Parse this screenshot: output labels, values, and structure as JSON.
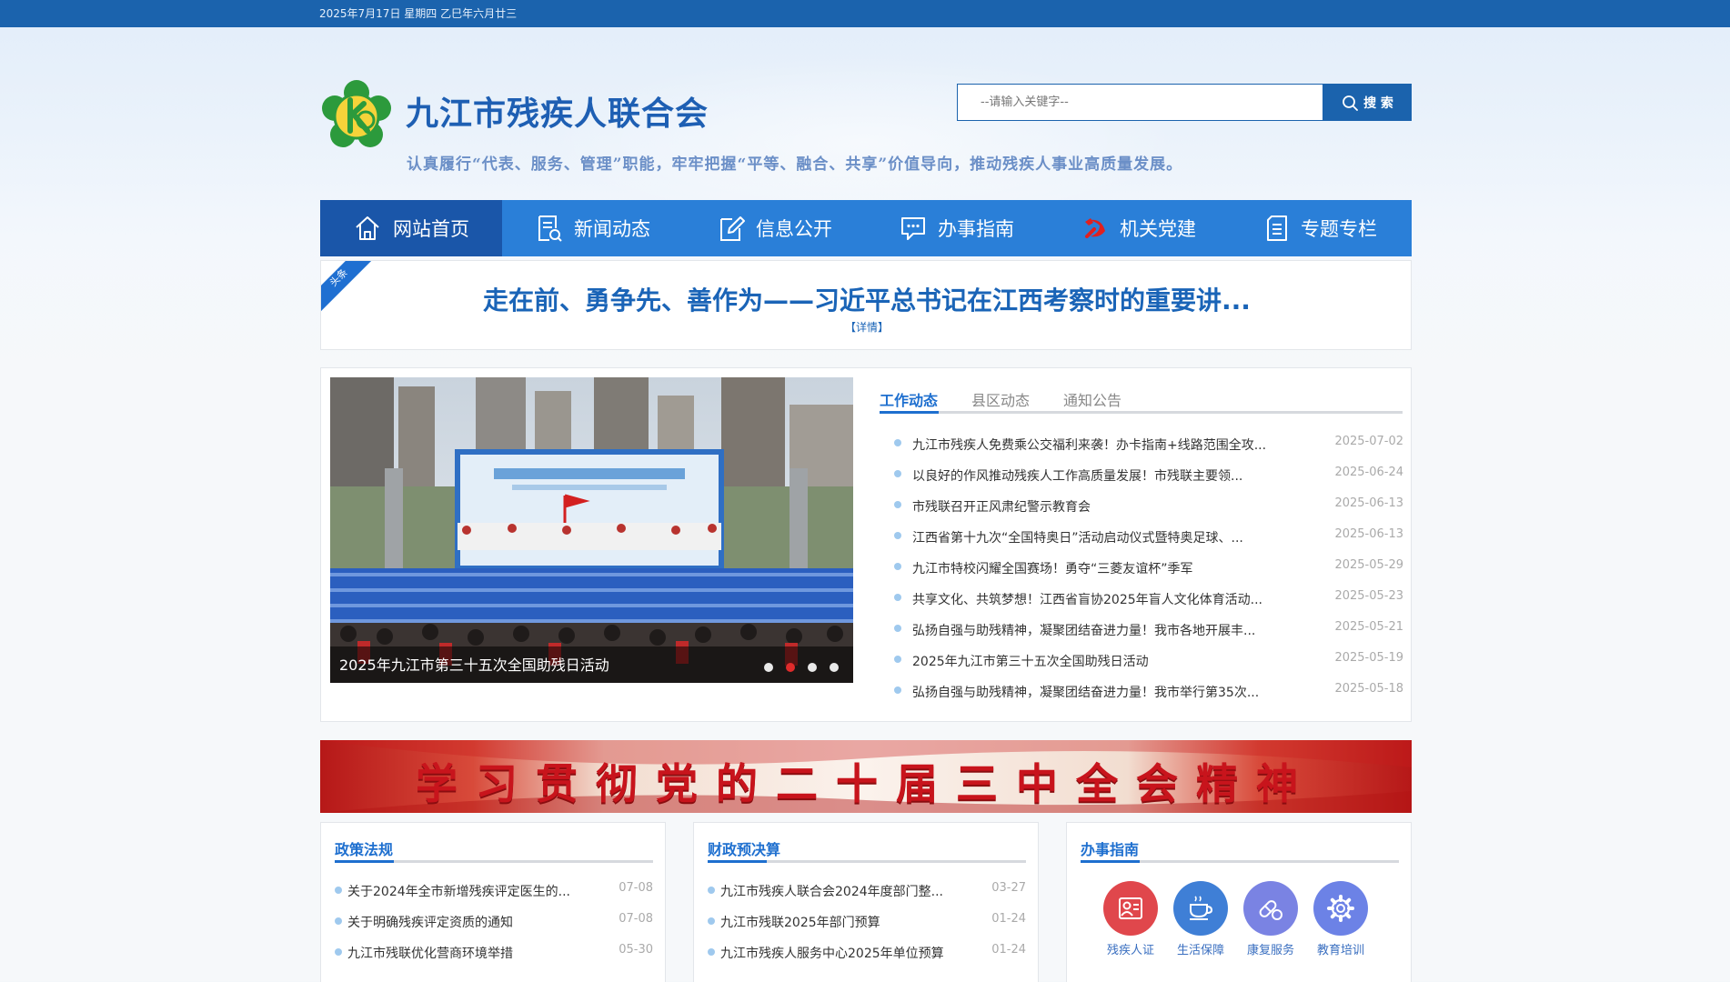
{
  "top_bar": {
    "date": "2025年7月17日  星期四  乙巳年六月廿三"
  },
  "header": {
    "title": "九江市残疾人联合会",
    "slogan": "认真履行“代表、服务、管理”职能，牢牢把握“平等、融合、共享”价值导向，推动残疾人事业高质量发展。",
    "logo_icon": "disability-federation-logo-icon"
  },
  "search": {
    "placeholder": "--请输入关键字--",
    "value": "",
    "button_label": "搜 索"
  },
  "nav": {
    "items": [
      {
        "label": "网站首页",
        "icon": "home-icon",
        "active": true
      },
      {
        "label": "新闻动态",
        "icon": "news-document-icon"
      },
      {
        "label": "信息公开",
        "icon": "edit-icon"
      },
      {
        "label": "办事指南",
        "icon": "chat-icon"
      },
      {
        "label": "机关党建",
        "icon": "party-emblem-icon"
      },
      {
        "label": "专题专栏",
        "icon": "document-list-icon"
      }
    ]
  },
  "headline": {
    "tag": "头条",
    "title": "走在前、勇争先、善作为——习近平总书记在江西考察时的重要讲...",
    "detail": "【详情】"
  },
  "slider": {
    "caption": "2025年九江市第三十五次全国助残日活动",
    "dots": 4,
    "active_dot": 2
  },
  "news_tabs": [
    {
      "label": "工作动态",
      "active": true
    },
    {
      "label": "县区动态"
    },
    {
      "label": "通知公告"
    }
  ],
  "news_list": [
    {
      "title": "九江市残疾人免费乘公交福利来袭！办卡指南+线路范围全攻...",
      "date": "2025-07-02"
    },
    {
      "title": "以良好的作风推动残疾人工作高质量发展！市残联主要领...",
      "date": "2025-06-24"
    },
    {
      "title": "市残联召开正风肃纪警示教育会",
      "date": "2025-06-13"
    },
    {
      "title": "江西省第十九次“全国特奥日”活动启动仪式暨特奥足球、...",
      "date": "2025-06-13"
    },
    {
      "title": "九江市特校闪耀全国赛场！勇夺“三菱友谊杯”季军",
      "date": "2025-05-29"
    },
    {
      "title": "共享文化、共筑梦想！江西省盲协2025年盲人文化体育活动...",
      "date": "2025-05-23"
    },
    {
      "title": "弘扬自强与助残精神，凝聚团结奋进力量！我市各地开展丰...",
      "date": "2025-05-21"
    },
    {
      "title": "2025年九江市第三十五次全国助残日活动",
      "date": "2025-05-19"
    },
    {
      "title": "弘扬自强与助残精神，凝聚团结奋进力量！我市举行第35次...",
      "date": "2025-05-18"
    }
  ],
  "banner": {
    "text": "学习贯彻党的二十届三中全会精神"
  },
  "policy": {
    "title": "政策法规",
    "items": [
      {
        "title": "关于2024年全市新增残疾评定医生的...",
        "date": "07-08"
      },
      {
        "title": "关于明确残疾评定资质的通知",
        "date": "07-08"
      },
      {
        "title": "九江市残联优化营商环境举措",
        "date": "05-30"
      }
    ]
  },
  "budget": {
    "title": "财政预决算",
    "items": [
      {
        "title": "九江市残疾人联合会2024年度部门整...",
        "date": "03-27"
      },
      {
        "title": "九江市残联2025年部门预算",
        "date": "01-24"
      },
      {
        "title": "九江市残疾人服务中心2025年单位预算",
        "date": "01-24"
      }
    ]
  },
  "guide": {
    "title": "办事指南",
    "services": [
      {
        "label": "残疾人证",
        "icon": "id-card-icon",
        "color": "#e0474c"
      },
      {
        "label": "生活保障",
        "icon": "cup-icon",
        "color": "#3f7fd6"
      },
      {
        "label": "康复服务",
        "icon": "pill-icon",
        "color": "#7a83e3"
      },
      {
        "label": "教育培训",
        "icon": "gear-icon",
        "color": "#6c82e6"
      }
    ]
  },
  "colors": {
    "top_bar": "#1b63ad",
    "nav": "#2a7fd8",
    "nav_active": "#1a56a9",
    "accent": "#1e6fcf",
    "banner_red": "#c8141c"
  }
}
